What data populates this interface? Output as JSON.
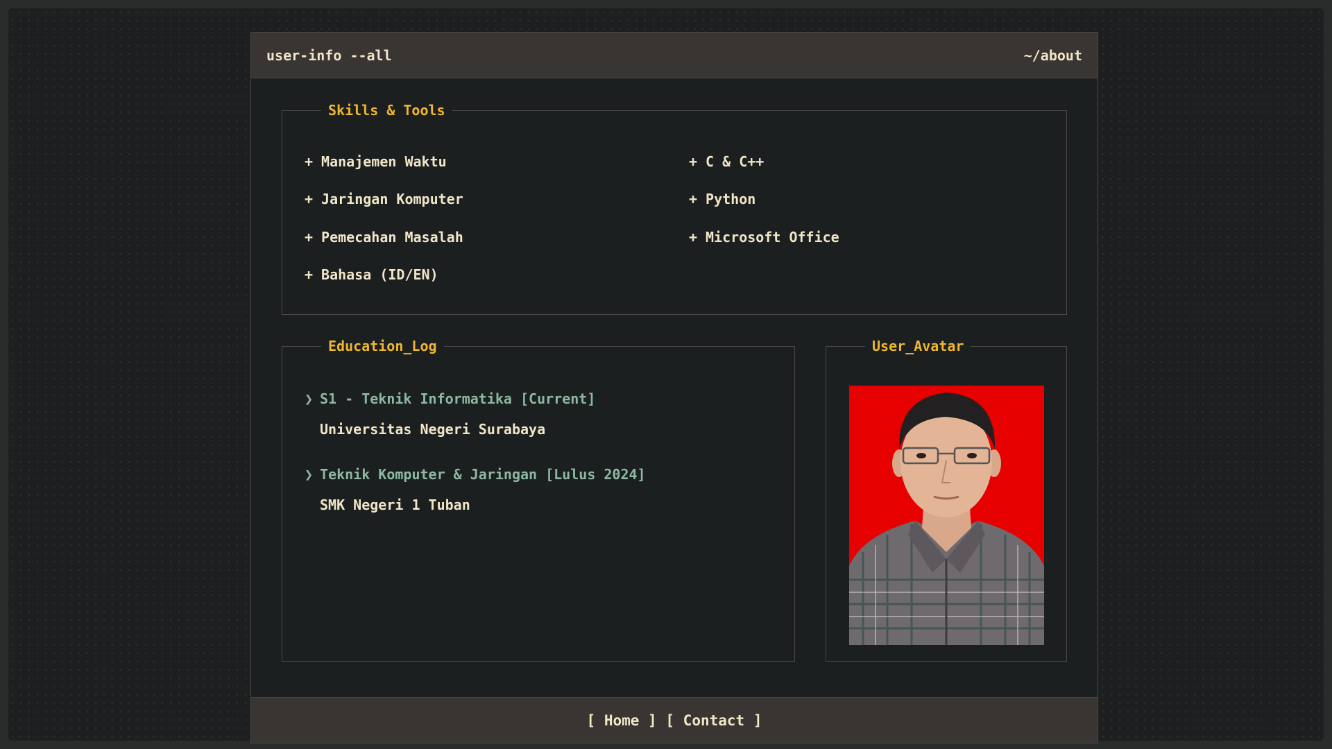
{
  "titlebar": {
    "command": "user-info --all",
    "path": "~/about"
  },
  "skills": {
    "legend": "Skills & Tools",
    "bullet": "+",
    "column1": [
      "Manajemen Waktu",
      "Jaringan Komputer",
      "Pemecahan Masalah",
      "Bahasa (ID/EN)"
    ],
    "column2": [
      "C & C++",
      "Python",
      "Microsoft Office"
    ]
  },
  "education": {
    "legend": "Education_Log",
    "bullet": "❯",
    "entries": [
      {
        "degree": "S1 - Teknik Informatika [Current]",
        "school": "Universitas Negeri Surabaya"
      },
      {
        "degree": "Teknik Komputer & Jaringan [Lulus 2024]",
        "school": "SMK Negeri 1 Tuban"
      }
    ]
  },
  "avatar": {
    "legend": "User_Avatar",
    "background_color": "#e60000"
  },
  "footer": {
    "open_bracket": "[",
    "close_bracket": "]",
    "links": [
      "Home",
      "Contact"
    ]
  },
  "colors": {
    "accent": "#f0b72f",
    "text": "#f1e6c8",
    "muted_green": "#8db8a3",
    "panel_bar": "#393532"
  }
}
